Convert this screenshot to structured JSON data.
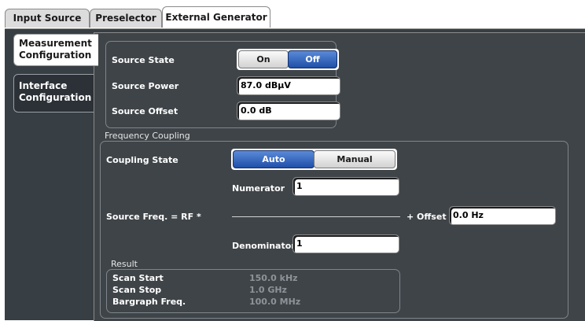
{
  "tabs": [
    "Input Source",
    "Preselector",
    "External Generator"
  ],
  "side_tabs": [
    "Measurement Configuration",
    "Interface Configuration"
  ],
  "measurement": {
    "source_state": {
      "label": "Source State",
      "options": [
        "On",
        "Off"
      ],
      "selected": "Off"
    },
    "source_power": {
      "label": "Source Power",
      "value": "87.0 dBµV"
    },
    "source_offset": {
      "label": "Source Offset",
      "value": "0.0 dB"
    }
  },
  "frequency_coupling": {
    "title": "Frequency Coupling",
    "coupling_state": {
      "label": "Coupling State",
      "options": [
        "Auto",
        "Manual"
      ],
      "selected": "Auto"
    },
    "numerator": {
      "label": "Numerator",
      "value": "1"
    },
    "formula_label": "Source Freq. = RF *",
    "offset": {
      "label": "+ Offset",
      "value": "0.0 Hz"
    },
    "denominator": {
      "label": "Denominator",
      "value": "1"
    }
  },
  "result": {
    "title": "Result",
    "rows": [
      {
        "label": "Scan Start",
        "value": "150.0 kHz"
      },
      {
        "label": "Scan Stop",
        "value": "1.0 GHz"
      },
      {
        "label": "Bargraph Freq.",
        "value": "100.0 MHz"
      }
    ]
  },
  "colors": {
    "panel": "#373e44",
    "content": "#3f4448",
    "selected_button": "#2a5cb8"
  }
}
